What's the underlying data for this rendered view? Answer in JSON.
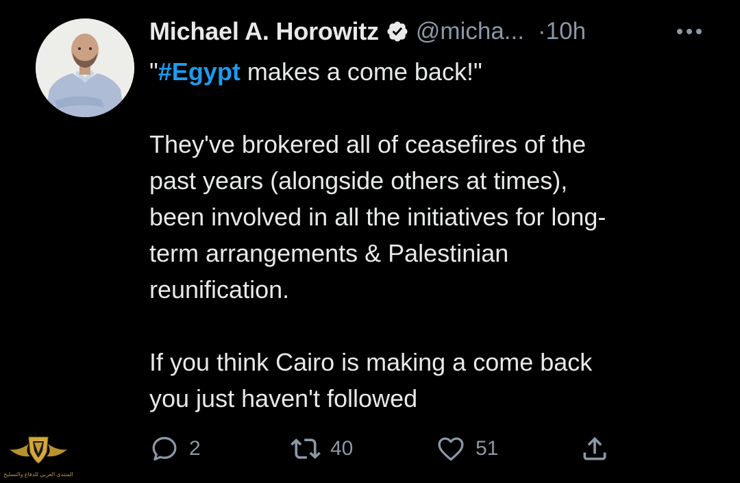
{
  "tweet": {
    "author": {
      "display_name": "Michael A. Horowitz",
      "handle": "@micha...",
      "verified": true,
      "avatar": "profile-photo"
    },
    "time": "·10h",
    "more_icon": "more-horizontal-icon",
    "body": {
      "line1_prefix": "\"",
      "hashtag": "#Egypt",
      "line1_suffix": " makes a come back!\"",
      "paragraph2": [
        "They've brokered all of ceasefires of the",
        "past years (alongside others at times),",
        "been involved in all the initiatives for long-",
        "term arrangements & Palestinian",
        "reunification."
      ],
      "paragraph3": [
        "If you think Cairo is making a come back",
        "you just haven't followed"
      ]
    },
    "actions": {
      "reply": {
        "icon": "reply-icon",
        "count": "2"
      },
      "retweet": {
        "icon": "retweet-icon",
        "count": "40"
      },
      "like": {
        "icon": "heart-icon",
        "count": "51"
      },
      "share": {
        "icon": "share-icon"
      }
    }
  },
  "watermark": {
    "logo": "golden-shield-logo",
    "text": "المنتدى العربي للدفاع والتسليح"
  },
  "colors": {
    "background": "#000000",
    "text": "#e7e9ea",
    "secondary": "#8b98a5",
    "hashtag": "#1d9bf0",
    "verified_badge": "#e7e9ea"
  }
}
